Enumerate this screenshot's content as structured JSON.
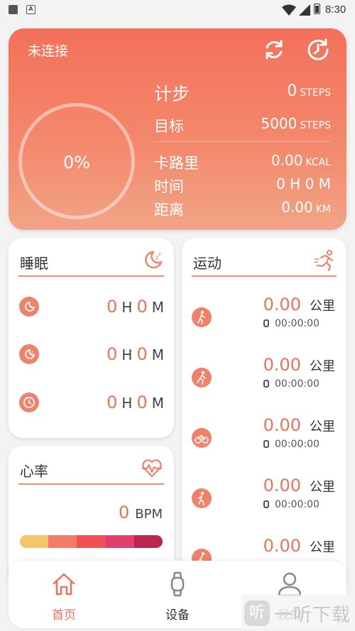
{
  "status_bar": {
    "time": "8:30"
  },
  "summary": {
    "status": "未连接",
    "progress_text": "0%",
    "progress": 0,
    "rows": [
      {
        "label": "计步",
        "value": "0",
        "unit": "STEPS"
      },
      {
        "label": "目标",
        "value": "5000",
        "unit": "STEPS"
      },
      {
        "label": "卡路里",
        "value": "0.00",
        "unit": "KCAL"
      },
      {
        "label": "时间",
        "value": "0 H 0 M",
        "unit": ""
      },
      {
        "label": "距离",
        "value": "0.00",
        "unit": "KM"
      }
    ]
  },
  "sleep": {
    "title": "睡眠",
    "rows": [
      {
        "h": "0",
        "hu": "H",
        "m": "0",
        "mu": "M"
      },
      {
        "h": "0",
        "hu": "H",
        "m": "0",
        "mu": "M"
      },
      {
        "h": "0",
        "hu": "H",
        "m": "0",
        "mu": "M"
      }
    ]
  },
  "heart_rate": {
    "title": "心率",
    "value": "0",
    "unit": "BPM",
    "zone_colors": [
      "#f5c56a",
      "#f47a6a",
      "#ef5156",
      "#e0406e",
      "#b8284e"
    ]
  },
  "sport": {
    "title": "运动",
    "rows": [
      {
        "distance": "0.00",
        "unit": "公里",
        "time": "00:00:00"
      },
      {
        "distance": "0.00",
        "unit": "公里",
        "time": "00:00:00"
      },
      {
        "distance": "0.00",
        "unit": "公里",
        "time": "00:00:00"
      },
      {
        "distance": "0.00",
        "unit": "公里",
        "time": "00:00:00"
      },
      {
        "distance": "0.00",
        "unit": "公里",
        "time": ""
      }
    ]
  },
  "tabs": [
    {
      "label": "首页",
      "icon": "home-icon",
      "active": true
    },
    {
      "label": "设备",
      "icon": "watch-icon",
      "active": false
    },
    {
      "label": "我的",
      "icon": "profile-icon",
      "active": false
    }
  ],
  "watermark": {
    "text": "一听下载"
  },
  "colors": {
    "accent": "#f0705a",
    "header_top": "#f4705a",
    "header_bottom": "#f2a486"
  }
}
